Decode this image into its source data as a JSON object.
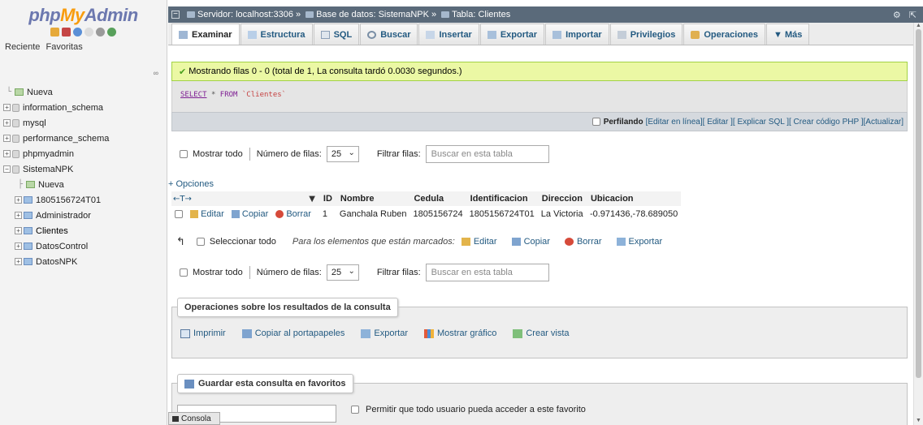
{
  "sidebar": {
    "logo": {
      "php": "php",
      "my": "My",
      "admin": "Admin"
    },
    "tabs": [
      "Reciente",
      "Favoritas"
    ],
    "link_icon": "∞",
    "tree": [
      {
        "label": "Nueva",
        "kind": "new",
        "level": 0
      },
      {
        "label": "information_schema",
        "kind": "db",
        "level": 0
      },
      {
        "label": "mysql",
        "kind": "db",
        "level": 0
      },
      {
        "label": "performance_schema",
        "kind": "db",
        "level": 0
      },
      {
        "label": "phpmyadmin",
        "kind": "db",
        "level": 0
      },
      {
        "label": "SistemaNPK",
        "kind": "db",
        "level": 0,
        "expanded": true
      },
      {
        "label": "Nueva",
        "kind": "new",
        "level": 1
      },
      {
        "label": "1805156724T01",
        "kind": "table",
        "level": 1
      },
      {
        "label": "Administrador",
        "kind": "table",
        "level": 1
      },
      {
        "label": "Clientes",
        "kind": "table",
        "level": 1,
        "active": true
      },
      {
        "label": "DatosControl",
        "kind": "table",
        "level": 1
      },
      {
        "label": "DatosNPK",
        "kind": "table",
        "level": 1
      }
    ]
  },
  "topbar": {
    "server": "Servidor: localhost:3306",
    "database": "Base de datos: SistemaNPK",
    "table": "Tabla: Clientes",
    "sep": "»"
  },
  "tabs": [
    {
      "label": "Examinar",
      "active": true,
      "icon": "browse-icon"
    },
    {
      "label": "Estructura",
      "icon": "structure-icon"
    },
    {
      "label": "SQL",
      "icon": "sql-icon"
    },
    {
      "label": "Buscar",
      "icon": "search-icon"
    },
    {
      "label": "Insertar",
      "icon": "insert-icon"
    },
    {
      "label": "Exportar",
      "icon": "export-icon"
    },
    {
      "label": "Importar",
      "icon": "import-icon"
    },
    {
      "label": "Privilegios",
      "icon": "privileges-icon"
    },
    {
      "label": "Operaciones",
      "icon": "operations-icon"
    },
    {
      "label": "▼ Más",
      "icon": ""
    }
  ],
  "success_message": "Mostrando filas 0 - 0 (total de 1, La consulta tardó 0.0030 segundos.)",
  "sql": {
    "select": "SELECT",
    "star": "*",
    "from": "FROM",
    "table": "`Clientes`"
  },
  "profile": {
    "label": "Perfilando",
    "links": [
      "[Editar en línea]",
      "[ Editar ]",
      "[ Explicar SQL ]",
      "[ Crear código PHP ]",
      "[Actualizar]"
    ]
  },
  "nav": {
    "show_all": "Mostrar todo",
    "rows_label": "Número de filas:",
    "rows_value": "25",
    "filter_label": "Filtrar filas:",
    "filter_placeholder": "Buscar en esta tabla"
  },
  "opciones": "+ Opciones",
  "table": {
    "arrows": "←T→",
    "sort": "▼",
    "columns": [
      "ID",
      "Nombre",
      "Cedula",
      "Identificacion",
      "Direccion",
      "Ubicacion"
    ],
    "row_actions": {
      "edit": "Editar",
      "copy": "Copiar",
      "delete": "Borrar"
    },
    "rows": [
      [
        "1",
        "Ganchala Ruben",
        "1805156724",
        "1805156724T01",
        "La Victoria",
        "-0.971436,-78.689050"
      ]
    ]
  },
  "mark_row": {
    "select_all": "Seleccionar todo",
    "for_marked": "Para los elementos que están marcados:",
    "edit": "Editar",
    "copy": "Copiar",
    "delete": "Borrar",
    "export": "Exportar"
  },
  "query_ops": {
    "legend": "Operaciones sobre los resultados de la consulta",
    "links": [
      "Imprimir",
      "Copiar al portapapeles",
      "Exportar",
      "Mostrar gráfico",
      "Crear vista"
    ]
  },
  "bookmark": {
    "legend": "Guardar esta consulta en favoritos",
    "permit": "Permitir que todo usuario pueda acceder a este favorito"
  },
  "console": "Consola",
  "colors": {
    "link": "#235a81",
    "success_bg": "#ebf8a4",
    "topbar": "#5a6a7a"
  }
}
